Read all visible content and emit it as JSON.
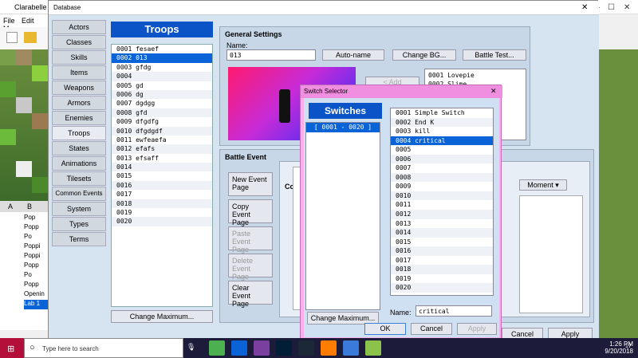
{
  "app": {
    "title": "Clarabelle - R",
    "menu": [
      "File",
      "Edit",
      "M"
    ],
    "tabs": [
      "A",
      "B"
    ],
    "tree": [
      "Pop",
      "Popp",
      "Po",
      "Poppi",
      "Poppi",
      "Popp",
      "Po",
      "Popp",
      "Openin",
      "Lab 1"
    ]
  },
  "db": {
    "title": "Database",
    "sidebar": [
      "Actors",
      "Classes",
      "Skills",
      "Items",
      "Weapons",
      "Armors",
      "Enemies",
      "Troops",
      "States",
      "Animations",
      "Tilesets",
      "Common Events",
      "System",
      "Types",
      "Terms"
    ],
    "active": "Troops",
    "troops_header": "Troops",
    "troops": [
      "0001 fesaef",
      "0002 013",
      "0003 gfdg",
      "0004",
      "0005 gd",
      "0006 dg",
      "0007 dgdgg",
      "0008 gfd",
      "0009 dfgdfg",
      "0010 dfgdgdf",
      "0011 ewfeaefa",
      "0012 efafs",
      "0013 efsaff",
      "0014",
      "0015",
      "0016",
      "0017",
      "0018",
      "0019",
      "0020"
    ],
    "change_max": "Change Maximum...",
    "general": {
      "title": "General Settings",
      "name_label": "Name:",
      "name_value": "013",
      "autoname": "Auto-name",
      "change_bg": "Change BG...",
      "battle_test": "Battle Test..."
    },
    "members_btn": "< Add",
    "enemies": [
      "0001 Lovepie",
      "0002 Slime"
    ],
    "battle_event": {
      "title": "Battle Event",
      "new": "New Event Page",
      "copy": "Copy Event Page",
      "paste": "Paste Event Page",
      "delete": "Delete Event Page",
      "clear": "Clear Event Page",
      "span": "Moment",
      "cond_short": "Co",
      "cond_head": "Co"
    },
    "cancel": "Cancel",
    "apply": "Apply"
  },
  "switch_selector": {
    "title": "Switch Selector",
    "header": "Switches",
    "group": "[ 0001 - 0020 ]",
    "items": [
      "0001 Simple Switch",
      "0002 End K",
      "0003 kill",
      "0004 critical",
      "0005",
      "0006",
      "0007",
      "0008",
      "0009",
      "0010",
      "0011",
      "0012",
      "0013",
      "0014",
      "0015",
      "0016",
      "0017",
      "0018",
      "0019",
      "0020"
    ],
    "selected": "0004 critical",
    "change_max": "Change Maximum...",
    "name_label": "Name:",
    "name_value": "critical",
    "ok": "OK",
    "cancel": "Cancel",
    "apply": "Apply"
  },
  "taskbar": {
    "search": "Type here to search",
    "time": "1:26 PM",
    "date": "9/20/2018",
    "notif": "17"
  }
}
